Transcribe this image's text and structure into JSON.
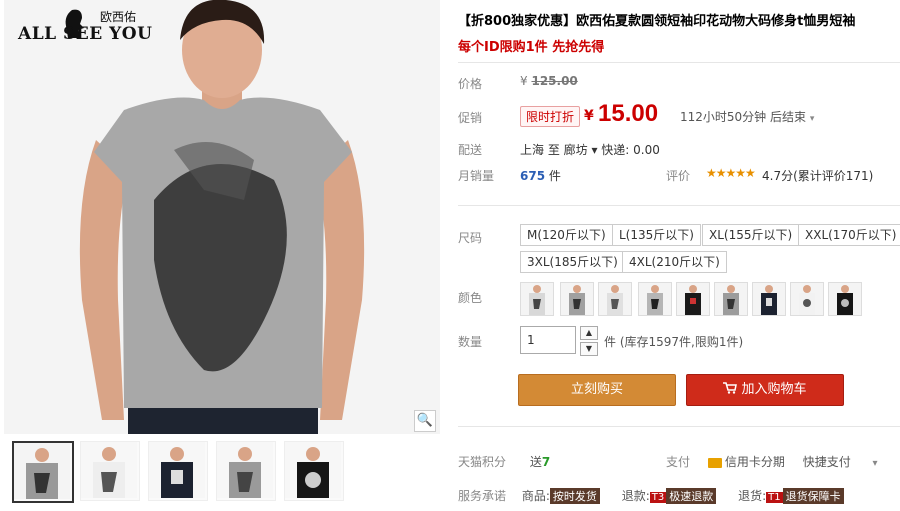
{
  "brand": {
    "chinese": "欧西佑",
    "english": "ALL SEE YOU"
  },
  "product": {
    "title": "【折800独家优惠】欧西佑夏款圆领短袖印花动物大码修身t恤男短袖",
    "subtitle": "每个ID限购1件 先抢先得"
  },
  "price": {
    "label": "价格",
    "currency": "¥",
    "original": "125.00",
    "promo_label": "促销",
    "promo_tag": "限时打折",
    "current": "15.00",
    "countdown": "112小时50分钟 后结束"
  },
  "shipping": {
    "label": "配送",
    "text": "上海  至  廊坊 ▾  快递: 0.00"
  },
  "sales": {
    "label": "月销量",
    "count": "675",
    "unit": "件",
    "review_label": "评价",
    "stars": "★★★★★",
    "score": "4.7分(累计评价171)"
  },
  "sizes": {
    "label": "尺码",
    "options": [
      "M(120斤以下)",
      "L(135斤以下)",
      "XL(155斤以下)",
      "XXL(170斤以下)",
      "3XL(185斤以下)",
      "4XL(210斤以下)"
    ]
  },
  "colors": {
    "label": "颜色"
  },
  "quantity": {
    "label": "数量",
    "value": "1",
    "stock_text": "件 (库存1597件,限购1件)"
  },
  "buttons": {
    "buy": "立刻购买",
    "cart": "加入购物车"
  },
  "footer": {
    "points_label": "天猫积分",
    "points_text": "送",
    "points_value": "7",
    "pay_label": "支付",
    "credit_text": "信用卡分期",
    "quick_pay": "快捷支付",
    "service_label": "服务承诺",
    "service_goods": "商品:",
    "service_goods_tag": "按时发货",
    "service_refund": "退款:",
    "service_refund_tag1": "T3",
    "service_refund_tag2": "极速退款",
    "service_return": "退货:",
    "service_return_tag1": "T1",
    "service_return_tag2": "退货保障卡"
  }
}
